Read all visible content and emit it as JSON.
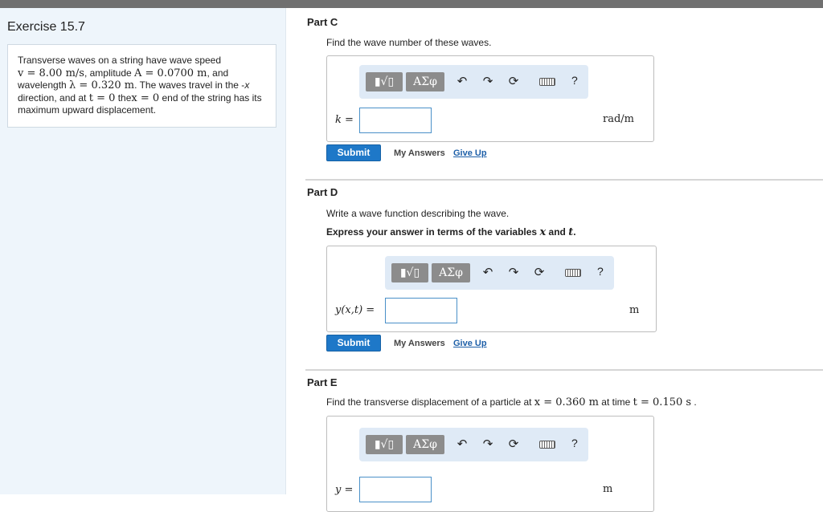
{
  "exercise": {
    "title": "Exercise 15.7",
    "problem": {
      "t1": "Transverse waves on a string have wave speed",
      "v_expr": "v = 8.00 m/s",
      "t2": ", amplitude ",
      "a_expr": "A = 0.0700 m",
      "t3": ", and",
      "t4": "wavelength ",
      "l_expr": "λ = 0.320 m",
      "t5": ". The waves travel in the -",
      "t5_var": "x",
      "t6": "direction, and at ",
      "t0_expr": "t = 0",
      "t7": " the",
      "x0_expr": "x = 0",
      "t8": " end of the string has its",
      "t9": "maximum upward displacement."
    }
  },
  "toolbar": {
    "template_btn": "▮√▯",
    "symbols_btn": "ΑΣφ",
    "help": "?"
  },
  "partC": {
    "title": "Part C",
    "prompt": "Find the wave number of these waves.",
    "var_label": "k =",
    "unit": "rad/m",
    "submit": "Submit",
    "my_answers": "My Answers",
    "give_up": "Give Up"
  },
  "partD": {
    "title": "Part D",
    "prompt": "Write a wave function describing the wave.",
    "instr_pre": "Express your answer in terms of the variables ",
    "instr_x": "x",
    "instr_and": " and ",
    "instr_t": "t",
    "instr_end": ".",
    "var_label": "y(x,t) =",
    "unit": "m",
    "submit": "Submit",
    "my_answers": "My Answers",
    "give_up": "Give Up"
  },
  "partE": {
    "title": "Part E",
    "prompt_pre": "Find the transverse displacement of a particle at ",
    "x_expr": "x = 0.360 m",
    "prompt_mid": " at time ",
    "t_expr": "t = 0.150 s",
    "prompt_end": " .",
    "var_label": "y =",
    "unit": "m"
  }
}
